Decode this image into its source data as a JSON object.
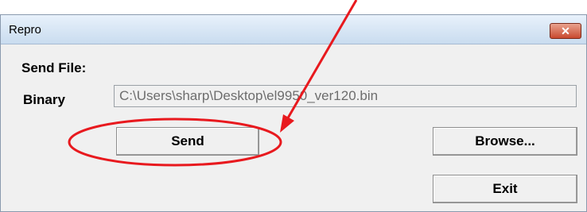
{
  "window": {
    "title": "Repro",
    "close_glyph": "✕"
  },
  "form": {
    "send_file_label": "Send File:",
    "binary_label": "Binary",
    "binary_path": "C:\\Users\\sharp\\Desktop\\el9950_ver120.bin"
  },
  "buttons": {
    "send": "Send",
    "browse": "Browse...",
    "exit": "Exit"
  },
  "annotation": {
    "color": "#e8191e",
    "icons": [
      "arrow-annotation",
      "ellipse-annotation"
    ]
  }
}
